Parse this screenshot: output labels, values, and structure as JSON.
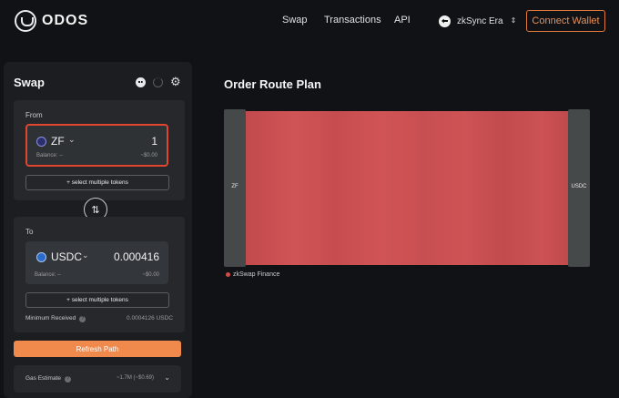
{
  "header": {
    "brand": "ODOS",
    "nav": [
      "Swap",
      "Transactions",
      "API"
    ],
    "network": "zkSync Era",
    "connect_label": "Connect Wallet"
  },
  "swap": {
    "title": "Swap",
    "from": {
      "label": "From",
      "token": "ZF",
      "amount": "1",
      "balance": "Balance: --",
      "usd": "~$0.00",
      "multi_label": "+ select multiple tokens"
    },
    "to": {
      "label": "To",
      "token": "USDC",
      "amount": "0.000416",
      "balance": "Balance: --",
      "usd": "~$0.00",
      "multi_label": "+ select multiple tokens"
    },
    "min_received_label": "Minimum Received",
    "min_received_value": "0.0004126 USDC",
    "refresh_label": "Refresh Path",
    "gas_label": "Gas Estimate",
    "gas_value": "~1.7M (~$0.69)"
  },
  "route": {
    "title": "Order Route Plan",
    "source_node": "ZF",
    "target_node": "USDC",
    "legend": "zkSwap Finance",
    "flow_color": "#c94f51"
  },
  "colors": {
    "accent": "#ef8a4c",
    "highlight": "#e0452f"
  }
}
